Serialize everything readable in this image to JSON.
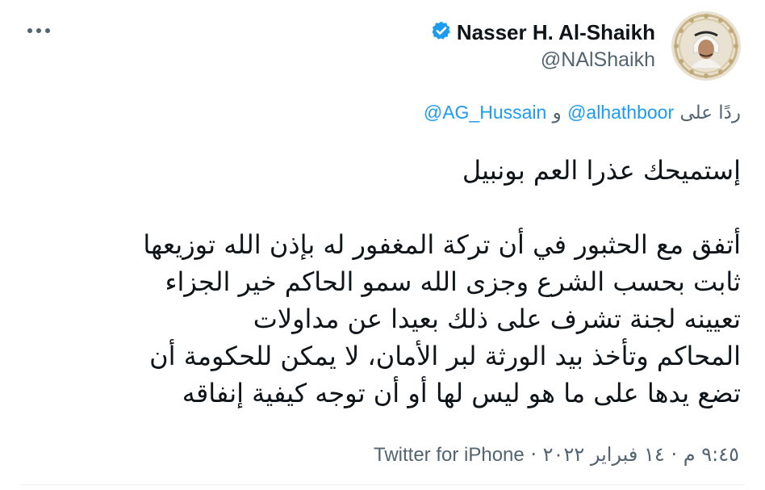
{
  "tweet": {
    "author": {
      "name": "Nasser H. Al-Shaikh",
      "handle": "@NAlShaikh",
      "verified": true,
      "avatar_icon": "profile-photo"
    },
    "more_icon": "more-dots-icon",
    "reply": {
      "prefix": "ردًا على",
      "mention1": "@alhathboor",
      "conjunction": "و",
      "mention2": "@AG_Hussain"
    },
    "text_lines": [
      "إستميحك عذرا العم بونبيل",
      "أتفق مع الحثبور في أن تركة المغفور له بإذن الله توزيعها",
      "ثابت بحسب الشرع وجزى الله سمو الحاكم خير الجزاء",
      "تعيينه لجنة تشرف على ذلك بعيدا عن مداولات",
      "المحاكم وتأخذ بيد الورثة لبر الأمان، لا يمكن للحكومة أن",
      "تضع يدها على ما هو ليس لها أو أن توجه كيفية إنفاقه"
    ],
    "meta": {
      "time": "٩:٤٥ م",
      "separator": "·",
      "date": "١٤ فبراير ٢٠٢٢",
      "source": "Twitter for iPhone"
    }
  },
  "colors": {
    "text": "#0f1419",
    "secondary": "#536471",
    "accent": "#1d9bf0"
  }
}
